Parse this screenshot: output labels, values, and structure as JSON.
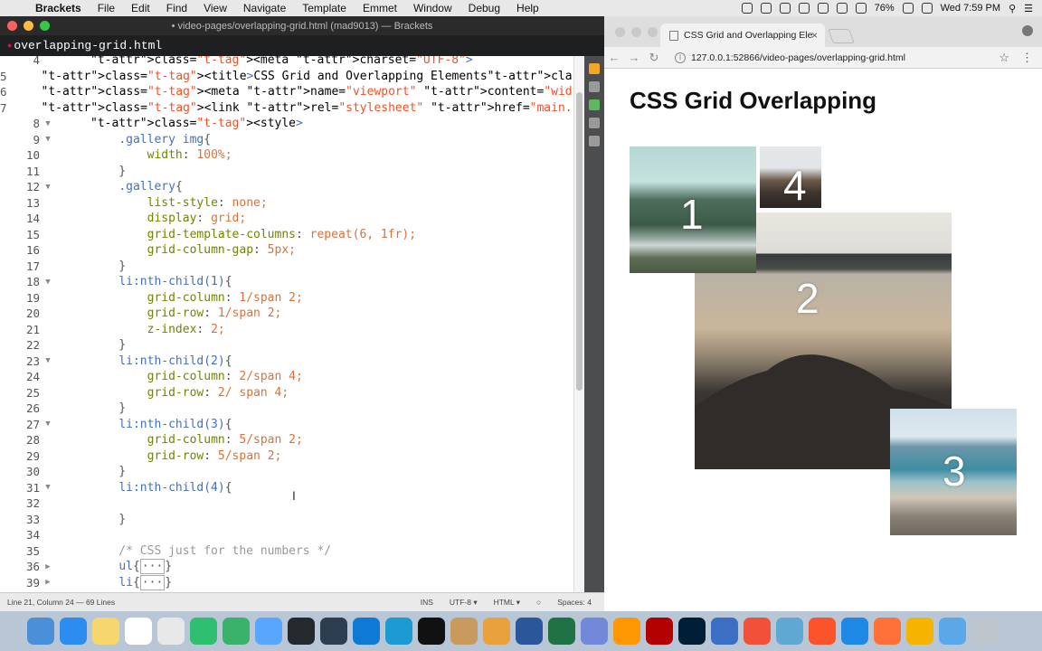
{
  "menubar": {
    "app_name": "Brackets",
    "items": [
      "File",
      "Edit",
      "Find",
      "View",
      "Navigate",
      "Template",
      "Emmet",
      "Window",
      "Debug",
      "Help"
    ],
    "battery": "76%",
    "clock": "Wed 7:59 PM"
  },
  "brackets": {
    "window_title": "• video-pages/overlapping-grid.html (mad9013) — Brackets",
    "file_tab": "overlapping-grid.html",
    "status": {
      "position": "Line 21, Column 24 — 69 Lines",
      "mode": "INS",
      "encoding": "UTF-8 ▾",
      "language": "HTML ▾",
      "spaces": "Spaces: 4"
    },
    "lines": [
      {
        "n": "4",
        "fold": "",
        "code": "<meta charset=\"UTF-8\">",
        "kind": "meta"
      },
      {
        "n": "5",
        "fold": "",
        "code": "<title>CSS Grid and Overlapping Elements</title>",
        "kind": "html"
      },
      {
        "n": "6",
        "fold": "",
        "code": "<meta name=\"viewport\" content=\"width=device-width\">",
        "kind": "html"
      },
      {
        "n": "7",
        "fold": "",
        "code": "<link rel=\"stylesheet\" href=\"main.css\" />",
        "kind": "html"
      },
      {
        "n": "8",
        "fold": "▼",
        "code": "<style>",
        "kind": "html"
      },
      {
        "n": "9",
        "fold": "▼",
        "code": "    .gallery img{",
        "kind": "sel"
      },
      {
        "n": "10",
        "fold": "",
        "code": "        width: 100%;",
        "kind": "prop"
      },
      {
        "n": "11",
        "fold": "",
        "code": "    }",
        "kind": "punc"
      },
      {
        "n": "12",
        "fold": "▼",
        "code": "    .gallery{",
        "kind": "sel"
      },
      {
        "n": "13",
        "fold": "",
        "code": "        list-style: none;",
        "kind": "prop"
      },
      {
        "n": "14",
        "fold": "",
        "code": "        display: grid;",
        "kind": "prop"
      },
      {
        "n": "15",
        "fold": "",
        "code": "        grid-template-columns: repeat(6, 1fr);",
        "kind": "prop"
      },
      {
        "n": "16",
        "fold": "",
        "code": "        grid-column-gap: 5px;",
        "kind": "prop"
      },
      {
        "n": "17",
        "fold": "",
        "code": "    }",
        "kind": "punc"
      },
      {
        "n": "18",
        "fold": "▼",
        "code": "    li:nth-child(1){",
        "kind": "sel"
      },
      {
        "n": "19",
        "fold": "",
        "code": "        grid-column: 1/span 2;",
        "kind": "prop"
      },
      {
        "n": "20",
        "fold": "",
        "code": "        grid-row: 1/span 2;",
        "kind": "prop"
      },
      {
        "n": "21",
        "fold": "",
        "code": "        z-index: 2;",
        "kind": "prop"
      },
      {
        "n": "22",
        "fold": "",
        "code": "    }",
        "kind": "punc"
      },
      {
        "n": "23",
        "fold": "▼",
        "code": "    li:nth-child(2){",
        "kind": "sel"
      },
      {
        "n": "24",
        "fold": "",
        "code": "        grid-column: 2/span 4;",
        "kind": "prop"
      },
      {
        "n": "25",
        "fold": "",
        "code": "        grid-row: 2/ span 4;",
        "kind": "prop"
      },
      {
        "n": "26",
        "fold": "",
        "code": "    }",
        "kind": "punc"
      },
      {
        "n": "27",
        "fold": "▼",
        "code": "    li:nth-child(3){",
        "kind": "sel"
      },
      {
        "n": "28",
        "fold": "",
        "code": "        grid-column: 5/span 2;",
        "kind": "prop"
      },
      {
        "n": "29",
        "fold": "",
        "code": "        grid-row: 5/span 2;",
        "kind": "prop"
      },
      {
        "n": "30",
        "fold": "",
        "code": "    }",
        "kind": "punc"
      },
      {
        "n": "31",
        "fold": "▼",
        "code": "    li:nth-child(4){",
        "kind": "sel"
      },
      {
        "n": "32",
        "fold": "",
        "code": "",
        "kind": "punc"
      },
      {
        "n": "33",
        "fold": "",
        "code": "    }",
        "kind": "punc"
      },
      {
        "n": "34",
        "fold": "",
        "code": "",
        "kind": "punc"
      },
      {
        "n": "35",
        "fold": "",
        "code": "    /* CSS just for the numbers */",
        "kind": "com"
      },
      {
        "n": "36",
        "fold": "▶",
        "code": "    ul{ ··· }",
        "kind": "folded"
      },
      {
        "n": "39",
        "fold": "▶",
        "code": "    li{ ··· }",
        "kind": "folded"
      }
    ]
  },
  "chrome": {
    "tab_title": "CSS Grid and Overlapping Ele",
    "url": "127.0.0.1:52866/video-pages/overlapping-grid.html",
    "page_heading": "CSS Grid Overlapping",
    "gallery": [
      {
        "number": "1",
        "scene": "mountain-river"
      },
      {
        "number": "2",
        "scene": "beach-rocks"
      },
      {
        "number": "3",
        "scene": "ocean-beach"
      },
      {
        "number": "4",
        "scene": "rocky-coast"
      }
    ]
  },
  "dock": {
    "apps": [
      "finder-icon",
      "app-store-icon",
      "notes-icon",
      "calendar-icon",
      "chrome-icon",
      "brackets-icon",
      "sourcetree-icon",
      "folder-icon",
      "github-icon",
      "atom-icon",
      "vscode-icon",
      "brackets-app-icon",
      "terminal-icon",
      "archive-icon",
      "tableplus-icon",
      "word-icon",
      "excel-icon",
      "discord-icon",
      "sublime-icon",
      "filezilla-icon",
      "photoshop-icon",
      "firefox-dev-icon",
      "swift-icon",
      "safari-tech-icon",
      "brave-icon",
      "safari-icon",
      "firefox-icon",
      "chrome-canary-icon",
      "downloads-icon",
      "trash-icon"
    ]
  },
  "colors": {
    "editor_bg": "#ffffff",
    "tag": "#446fbd",
    "attr": "#6b3fb3",
    "string": "#e8552a",
    "property": "#6d8600",
    "value": "#d6733b",
    "comment": "#999999"
  }
}
